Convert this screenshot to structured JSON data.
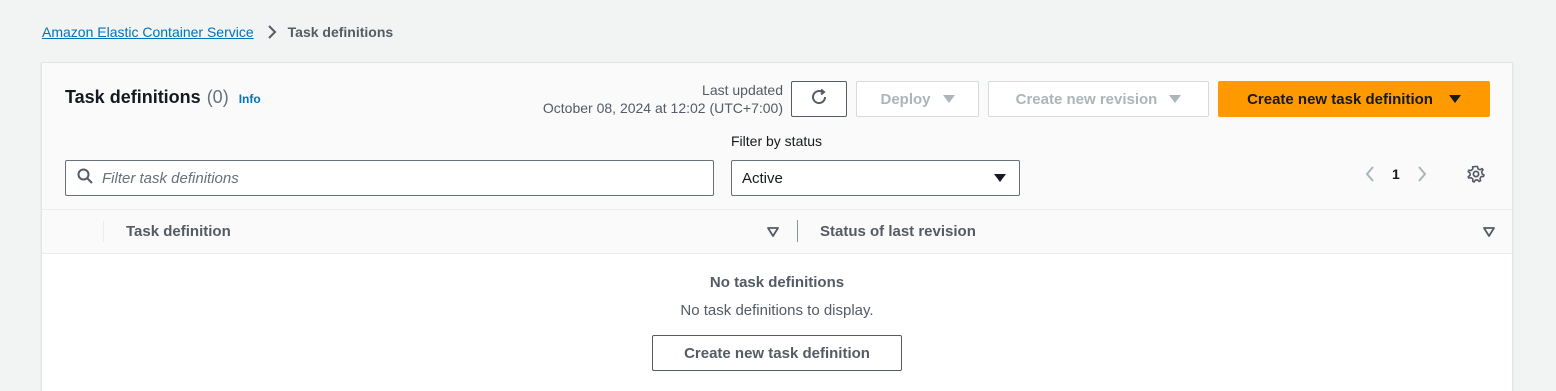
{
  "breadcrumb": {
    "parent": "Amazon Elastic Container Service",
    "current": "Task definitions"
  },
  "header": {
    "title": "Task definitions",
    "count": "(0)",
    "info": "Info",
    "last_updated_label": "Last updated",
    "last_updated_value": "October 08, 2024 at 12:02 (UTC+7:00)",
    "refresh_icon": "refresh-icon",
    "deploy_label": "Deploy",
    "create_revision_label": "Create new revision",
    "create_task_label": "Create new task definition"
  },
  "filters": {
    "search_placeholder": "Filter task definitions",
    "search_value": "",
    "status_label": "Filter by status",
    "status_selected": "Active"
  },
  "pagination": {
    "current_page": "1"
  },
  "table": {
    "columns": [
      "Task definition",
      "Status of last revision"
    ],
    "rows": []
  },
  "empty_state": {
    "heading": "No task definitions",
    "message": "No task definitions to display.",
    "button_label": "Create new task definition"
  },
  "colors": {
    "link": "#0073bb",
    "primary_button": "#ff9900",
    "background": "#f2f3f3"
  }
}
